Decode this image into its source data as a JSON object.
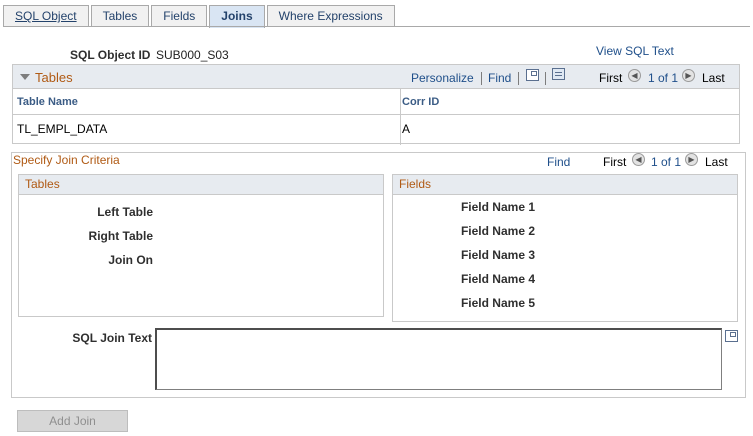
{
  "tabs": [
    {
      "label": "SQL Object"
    },
    {
      "label": "Tables"
    },
    {
      "label": "Fields"
    },
    {
      "label": "Joins"
    },
    {
      "label": "Where Expressions"
    }
  ],
  "header": {
    "sql_object_label": "SQL Object ID",
    "sql_object_value": "SUB000_S03",
    "view_sql_link": "View SQL Text"
  },
  "tables_grid": {
    "title": "Tables",
    "personalize": "Personalize",
    "find": "Find",
    "first": "First",
    "range": "1 of 1",
    "last": "Last",
    "columns": [
      "Table Name",
      "Corr ID"
    ],
    "rows": [
      [
        "TL_EMPL_DATA",
        "A"
      ]
    ]
  },
  "join_criteria": {
    "title": "Specify Join Criteria",
    "find": "Find",
    "first": "First",
    "range": "1 of 1",
    "last": "Last",
    "tables_panel": {
      "title": "Tables",
      "labels": [
        "Left Table",
        "Right Table",
        "Join On"
      ]
    },
    "fields_panel": {
      "title": "Fields",
      "labels": [
        "Field Name 1",
        "Field Name 2",
        "Field Name 3",
        "Field Name 4",
        "Field Name 5"
      ]
    },
    "sql_join_text_label": "SQL Join Text",
    "sql_join_text_value": ""
  },
  "add_join_button": "Add Join",
  "colors": {
    "tab_active_bg": "#d9e5f3",
    "section_title": "#b05a14",
    "link": "#1f4f8a",
    "header_bg": "#e7ebf0"
  }
}
